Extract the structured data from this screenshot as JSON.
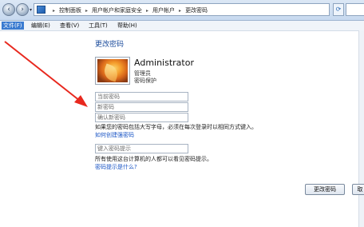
{
  "address_bar": {
    "breadcrumbs": [
      "控制面板",
      "用户帐户和家庭安全",
      "用户帐户",
      "更改密码"
    ],
    "refresh_icon": "refresh-icon",
    "back_icon": "back-arrow-icon",
    "forward_icon": "forward-arrow-icon"
  },
  "menu": {
    "items": [
      "文件(F)",
      "编辑(E)",
      "查看(V)",
      "工具(T)",
      "帮助(H)"
    ]
  },
  "page": {
    "title": "更改密码"
  },
  "user": {
    "name": "Administrator",
    "role": "管理员",
    "status": "密码保护"
  },
  "form": {
    "current_password_placeholder": "当前密码",
    "new_password_placeholder": "新密码",
    "confirm_password_placeholder": "确认新密码",
    "caps_note": "如果您的密码包括大写字母，必须在每次登录时以相同方式键入。",
    "strong_password_link": "如何创建强密码",
    "hint_placeholder": "键入密码提示",
    "hint_note": "所有使用这台计算机的人都可以看见密码提示。",
    "hint_link": "密码提示是什么?"
  },
  "buttons": {
    "change_password": "更改密码",
    "cancel": "取"
  },
  "colors": {
    "arrow": "#e8281e",
    "link": "#1a55c5",
    "title": "#1c4c9c"
  }
}
